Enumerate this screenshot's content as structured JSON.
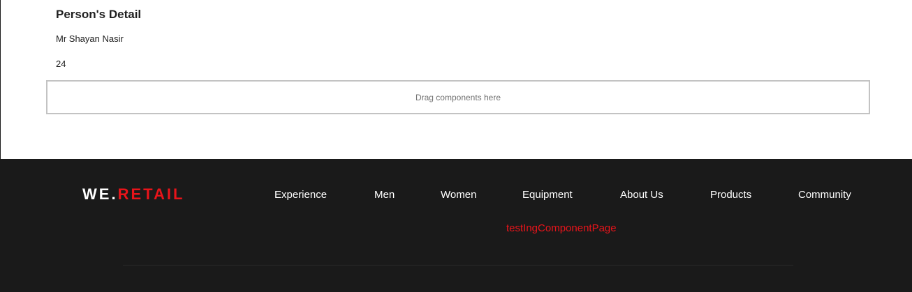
{
  "person": {
    "heading": "Person's Detail",
    "name": "Mr Shayan Nasir",
    "age": "24"
  },
  "dropzone": {
    "label": "Drag components here"
  },
  "footer": {
    "logo": {
      "part1": "WE",
      "dot": ".",
      "part2": "RETAIL"
    },
    "nav": [
      {
        "label": "Experience"
      },
      {
        "label": "Men"
      },
      {
        "label": "Women"
      },
      {
        "label": "Equipment"
      },
      {
        "label": "About Us"
      },
      {
        "label": "Products"
      },
      {
        "label": "Community"
      }
    ],
    "sub_nav_label": "testIngComponentPage"
  },
  "colors": {
    "footer_bg": "#1a1a1a",
    "accent": "#e8141a",
    "text_dark": "#202020"
  }
}
